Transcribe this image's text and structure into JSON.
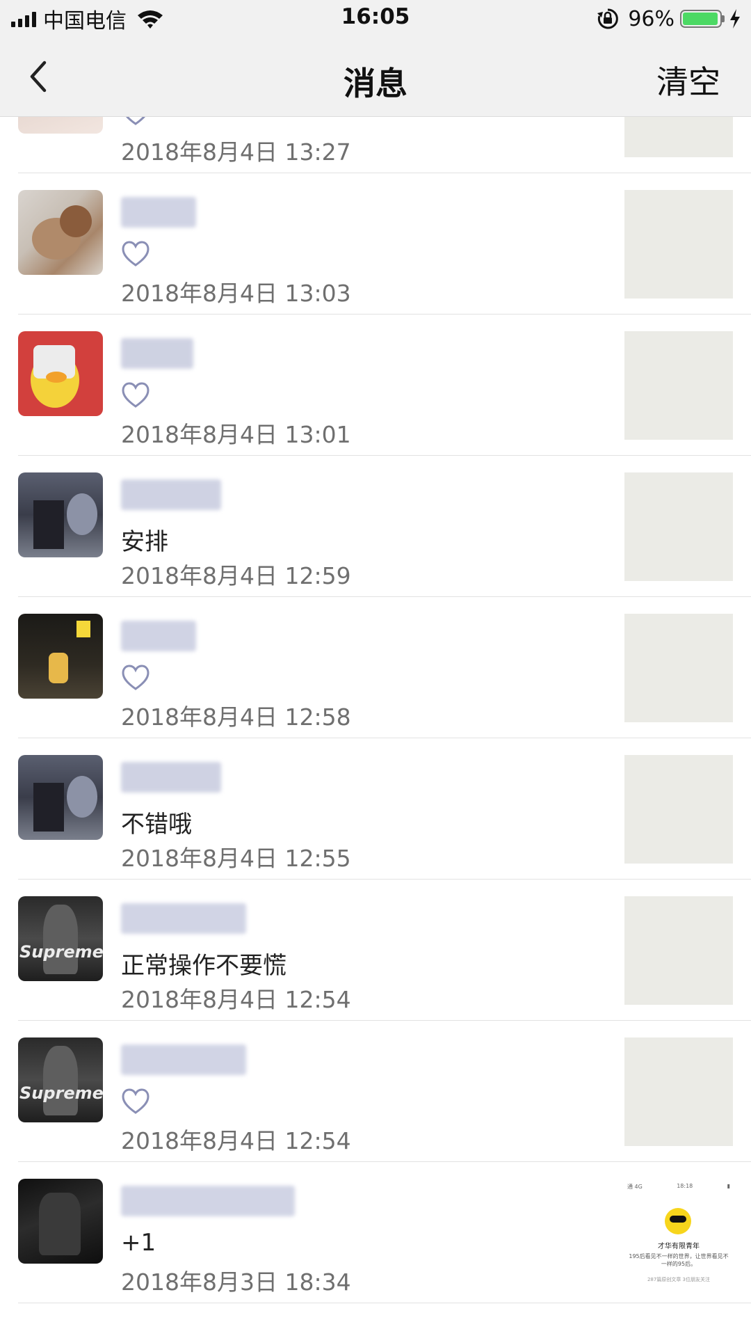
{
  "status_bar": {
    "carrier": "中国电信",
    "time": "16:05",
    "battery_percent": "96%",
    "battery_level": 0.96
  },
  "nav": {
    "title": "消息",
    "clear_label": "清空"
  },
  "messages": [
    {
      "type": "like",
      "time": "2018年8月4日 13:27"
    },
    {
      "type": "like",
      "time": "2018年8月4日 13:03"
    },
    {
      "type": "like",
      "time": "2018年8月4日 13:01"
    },
    {
      "type": "comment",
      "comment": "安排",
      "time": "2018年8月4日 12:59"
    },
    {
      "type": "like",
      "time": "2018年8月4日 12:58"
    },
    {
      "type": "comment",
      "comment": "不错哦",
      "time": "2018年8月4日 12:55"
    },
    {
      "type": "comment",
      "comment": "正常操作不要慌",
      "time": "2018年8月4日 12:54"
    },
    {
      "type": "like",
      "time": "2018年8月4日 12:54"
    },
    {
      "type": "comment",
      "comment": "+1",
      "time": "2018年8月3日 18:34"
    }
  ],
  "last_thumbnail": {
    "status_left": "通 4G",
    "status_time": "18:18",
    "name": "才华有限青年",
    "description": "195后看见不一样的世界，让世界看见不一样的95后。",
    "footer": "287篇原创文章 3位朋友关注"
  },
  "avatar_labels": {
    "supreme": "Supreme"
  },
  "icons": {
    "back": "chevron-left-icon",
    "like": "heart-outline-icon",
    "wifi": "wifi-icon",
    "orientation_lock": "orientation-lock-icon",
    "charging": "bolt-icon"
  },
  "colors": {
    "bar_background": "#f1f1f1",
    "heart": "#8a8fb5",
    "battery": "#4cd964",
    "time_text": "#6f6f6f"
  }
}
